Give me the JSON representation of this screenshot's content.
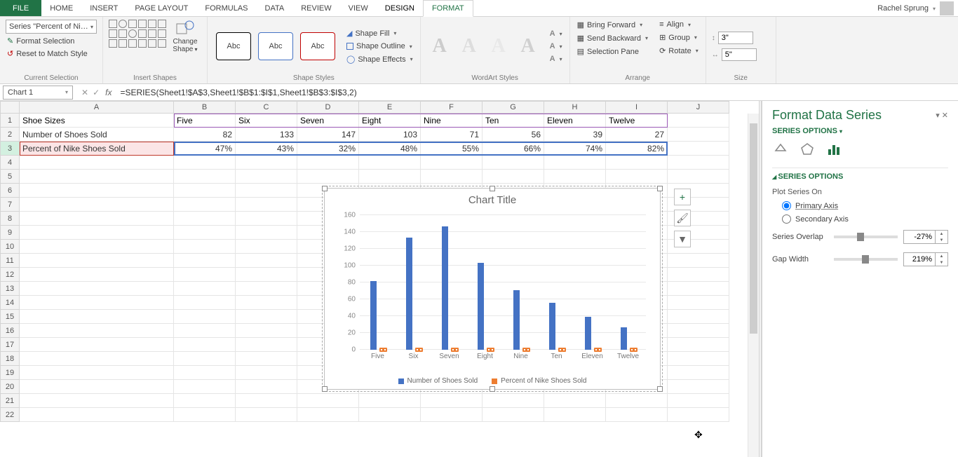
{
  "tabs": {
    "file": "FILE",
    "items": [
      "HOME",
      "INSERT",
      "PAGE LAYOUT",
      "FORMULAS",
      "DATA",
      "REVIEW",
      "VIEW"
    ],
    "tool_tabs": [
      "DESIGN",
      "FORMAT"
    ],
    "active": "FORMAT"
  },
  "user": {
    "name": "Rachel Sprung"
  },
  "ribbon": {
    "selection": {
      "current_value": "Series \"Percent of Nike S",
      "format_selection": "Format Selection",
      "reset": "Reset to Match Style",
      "group": "Current Selection"
    },
    "insert_shapes": {
      "change_shape": "Change Shape",
      "group": "Insert Shapes"
    },
    "shape_styles": {
      "sample_text": "Abc",
      "fill": "Shape Fill",
      "outline": "Shape Outline",
      "effects": "Shape Effects",
      "group": "Shape Styles"
    },
    "wordart": {
      "sample": "A",
      "group": "WordArt Styles"
    },
    "arrange": {
      "bring_forward": "Bring Forward",
      "send_backward": "Send Backward",
      "selection_pane": "Selection Pane",
      "align": "Align",
      "group_btn": "Group",
      "rotate": "Rotate",
      "group": "Arrange"
    },
    "size": {
      "height": "3\"",
      "width": "5\"",
      "group": "Size"
    }
  },
  "formula_bar": {
    "name_box": "Chart 1",
    "formula": "=SERIES(Sheet1!$A$3,Sheet1!$B$1:$I$1,Sheet1!$B$3:$I$3,2)"
  },
  "columns": [
    "A",
    "B",
    "C",
    "D",
    "E",
    "F",
    "G",
    "H",
    "I",
    "J"
  ],
  "table": {
    "row1_label": "Shoe Sizes",
    "row1_values": [
      "Five",
      "Six",
      "Seven",
      "Eight",
      "Nine",
      "Ten",
      "Eleven",
      "Twelve"
    ],
    "row2_label": "Number of Shoes Sold",
    "row2_values": [
      "82",
      "133",
      "147",
      "103",
      "71",
      "56",
      "39",
      "27"
    ],
    "row3_label": "Percent of Nike Shoes Sold",
    "row3_values": [
      "47%",
      "43%",
      "32%",
      "48%",
      "55%",
      "66%",
      "74%",
      "82%"
    ]
  },
  "chart_data": {
    "type": "bar",
    "title": "Chart Title",
    "categories": [
      "Five",
      "Six",
      "Seven",
      "Eight",
      "Nine",
      "Ten",
      "Eleven",
      "Twelve"
    ],
    "series": [
      {
        "name": "Number of Shoes Sold",
        "values": [
          82,
          133,
          147,
          103,
          71,
          56,
          39,
          27
        ],
        "color": "#4472c4"
      },
      {
        "name": "Percent of Nike Shoes Sold",
        "values": [
          0.47,
          0.43,
          0.32,
          0.48,
          0.55,
          0.66,
          0.74,
          0.82
        ],
        "color": "#ed7d31"
      }
    ],
    "ymax": 160,
    "ystep": 20,
    "yticks": [
      "0",
      "20",
      "40",
      "60",
      "80",
      "100",
      "120",
      "140",
      "160"
    ]
  },
  "task_pane": {
    "title": "Format Data Series",
    "subtitle": "SERIES OPTIONS",
    "section": "SERIES OPTIONS",
    "plot_on_label": "Plot Series On",
    "primary": "Primary Axis",
    "secondary": "Secondary Axis",
    "overlap_label": "Series Overlap",
    "overlap_value": "-27%",
    "gap_label": "Gap Width",
    "gap_value": "219%"
  }
}
